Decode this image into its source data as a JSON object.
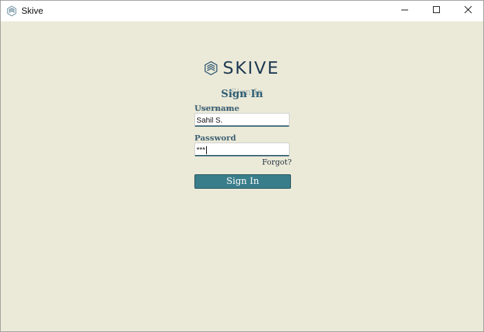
{
  "window": {
    "title": "Skive",
    "icon": "skive-logo-icon"
  },
  "controls": {
    "minimize_icon": "minimize-icon",
    "maximize_icon": "maximize-icon",
    "close_icon": "close-icon"
  },
  "brand": {
    "name": "SKIVE",
    "color": "#1e3a52"
  },
  "form": {
    "heading": "Sign In",
    "heading_ghost": "Sign In",
    "username_label": "Username",
    "username_ghost": "Username",
    "username_value": "Sahil S.",
    "password_label": "Password",
    "password_value": "***",
    "forgot_label": "Forgot?",
    "submit_label": "Sign In"
  },
  "colors": {
    "background": "#ebe9d8",
    "accent": "#3a7d8a",
    "label": "#3f6274"
  }
}
